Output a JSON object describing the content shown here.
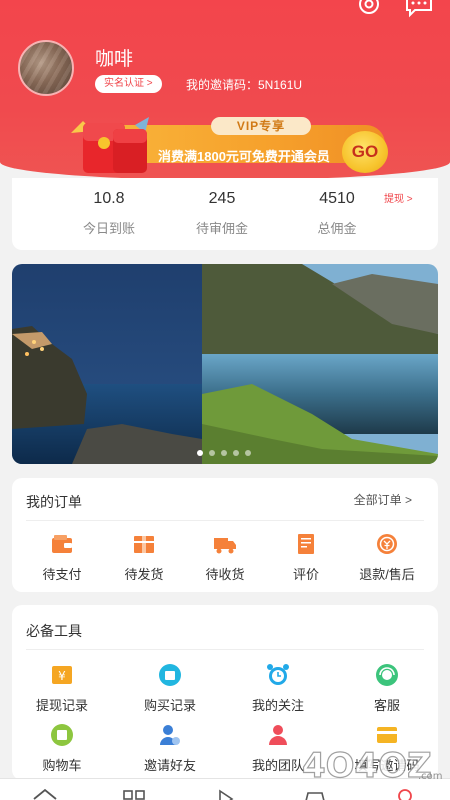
{
  "header": {
    "username": "咖啡",
    "verify_label": "实名认证 >",
    "invite_text": "我的邀请码：5N161U"
  },
  "banner": {
    "vip_label": "VIP专享",
    "promo_text": "消费满1800元可免费开通会员",
    "go_label": "GO"
  },
  "stats": {
    "withdraw_label": "提现 >",
    "items": [
      {
        "value": "10.8",
        "label": "今日到账"
      },
      {
        "value": "245",
        "label": "待审佣金"
      },
      {
        "value": "4510",
        "label": "总佣金"
      }
    ]
  },
  "carousel": {
    "slides": 5,
    "active_index": 0
  },
  "orders": {
    "title": "我的订单",
    "all_label": "全部订单 >",
    "items": [
      {
        "label": "待支付",
        "icon": "wallet-icon"
      },
      {
        "label": "待发货",
        "icon": "package-icon"
      },
      {
        "label": "待收货",
        "icon": "truck-icon"
      },
      {
        "label": "评价",
        "icon": "review-icon"
      },
      {
        "label": "退款/售后",
        "icon": "refund-icon"
      }
    ]
  },
  "tools": {
    "title": "必备工具",
    "items": [
      {
        "label": "提现记录",
        "icon": "withdraw-record-icon"
      },
      {
        "label": "购买记录",
        "icon": "purchase-record-icon"
      },
      {
        "label": "我的关注",
        "icon": "alarm-clock-icon"
      },
      {
        "label": "客服",
        "icon": "customer-service-icon"
      },
      {
        "label": "购物车",
        "icon": "shopping-cart-icon"
      },
      {
        "label": "邀请好友",
        "icon": "invite-friend-icon"
      },
      {
        "label": "我的团队",
        "icon": "team-icon"
      },
      {
        "label": "填写邀请码",
        "icon": "invite-code-icon"
      }
    ]
  },
  "colors": {
    "brand_red": "#f0464b",
    "orange": "#f5813a",
    "gold": "#f7c42d"
  },
  "watermark": "4O4OZ.com"
}
